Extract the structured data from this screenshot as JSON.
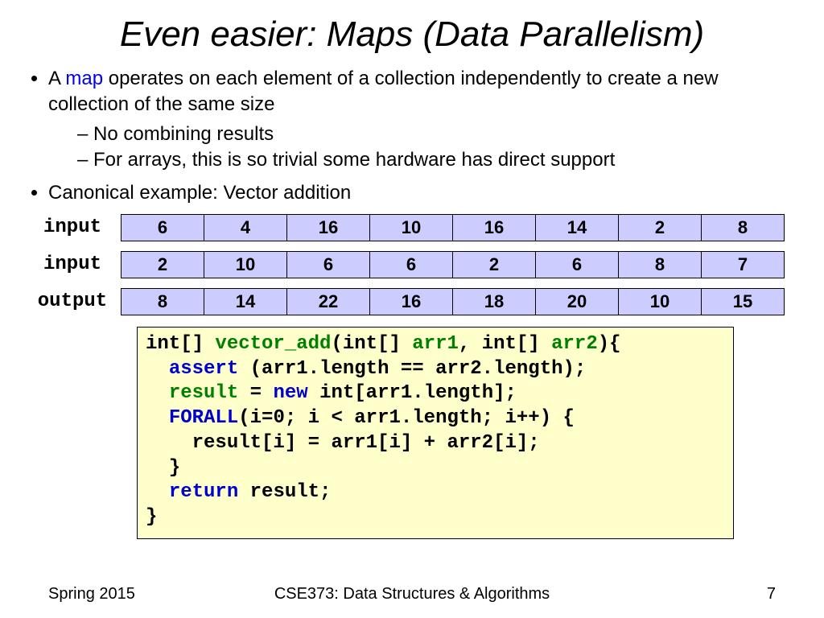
{
  "title": "Even easier: Maps (Data Parallelism)",
  "bullets": {
    "b1_pre": "A ",
    "b1_map": "map",
    "b1_post": " operates on each element of a collection independently to create a new collection of the same size",
    "b1a": "No combining results",
    "b1b": "For arrays, this is so trivial some hardware has direct support",
    "b2": "Canonical example: Vector addition"
  },
  "rows": {
    "r1_label": "input",
    "r1": [
      "6",
      "4",
      "16",
      "10",
      "16",
      "14",
      "2",
      "8"
    ],
    "r2_label": "input",
    "r2": [
      "2",
      "10",
      "6",
      "6",
      "2",
      "6",
      "8",
      "7"
    ],
    "r3_label": "output",
    "r3": [
      "8",
      "14",
      "22",
      "16",
      "18",
      "20",
      "10",
      "15"
    ]
  },
  "code": {
    "l1a": "int[] ",
    "l1b": "vector_add",
    "l1c": "(int[] ",
    "l1d": "arr1",
    "l1e": ", int[] ",
    "l1f": "arr2",
    "l1g": "){",
    "l2a": "  ",
    "l2b": "assert",
    "l2c": " (arr1.length == arr2.length);",
    "l3a": "  ",
    "l3b": "result",
    "l3c": " = ",
    "l3d": "new",
    "l3e": " int[arr1.length];",
    "l4a": "  ",
    "l4b": "FORALL",
    "l4c": "(i=0; i < arr1.length; i++) {",
    "l5": "    result[i] = arr1[i] + arr2[i];",
    "l6": "  }",
    "l7a": "  ",
    "l7b": "return",
    "l7c": " result;",
    "l8": "}"
  },
  "footer": {
    "left": "Spring 2015",
    "center": "CSE373: Data Structures & Algorithms",
    "right": "7"
  }
}
